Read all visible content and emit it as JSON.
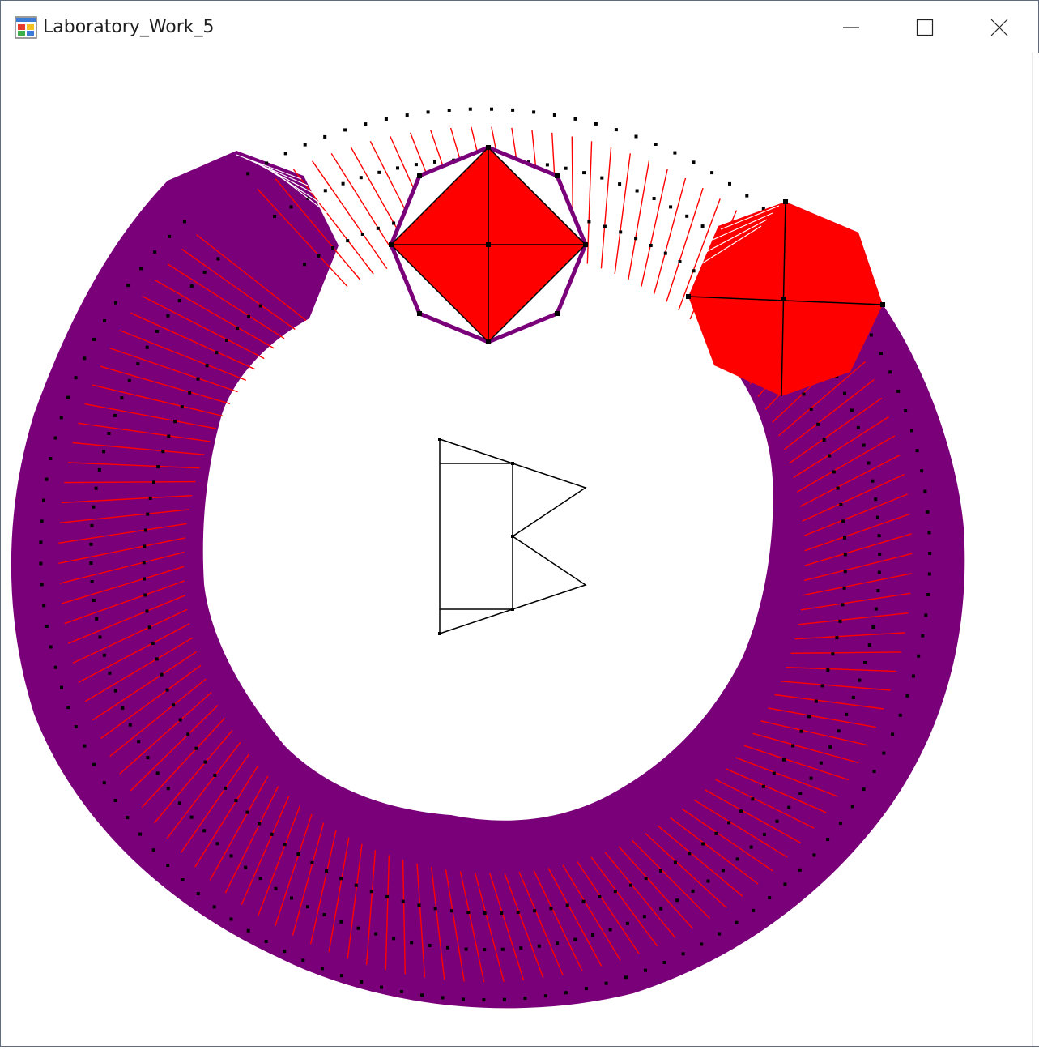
{
  "window": {
    "title": "Laboratory_Work_5",
    "icons": {
      "app": "application-icon",
      "minimize": "minimize-icon",
      "maximize": "maximize-icon",
      "close": "close-icon"
    }
  },
  "colors": {
    "sweep_outline": "#7a007a",
    "sweep_fill": "#ff0000",
    "edge": "#000000",
    "vertex": "#000000",
    "background": "#ffffff"
  }
}
